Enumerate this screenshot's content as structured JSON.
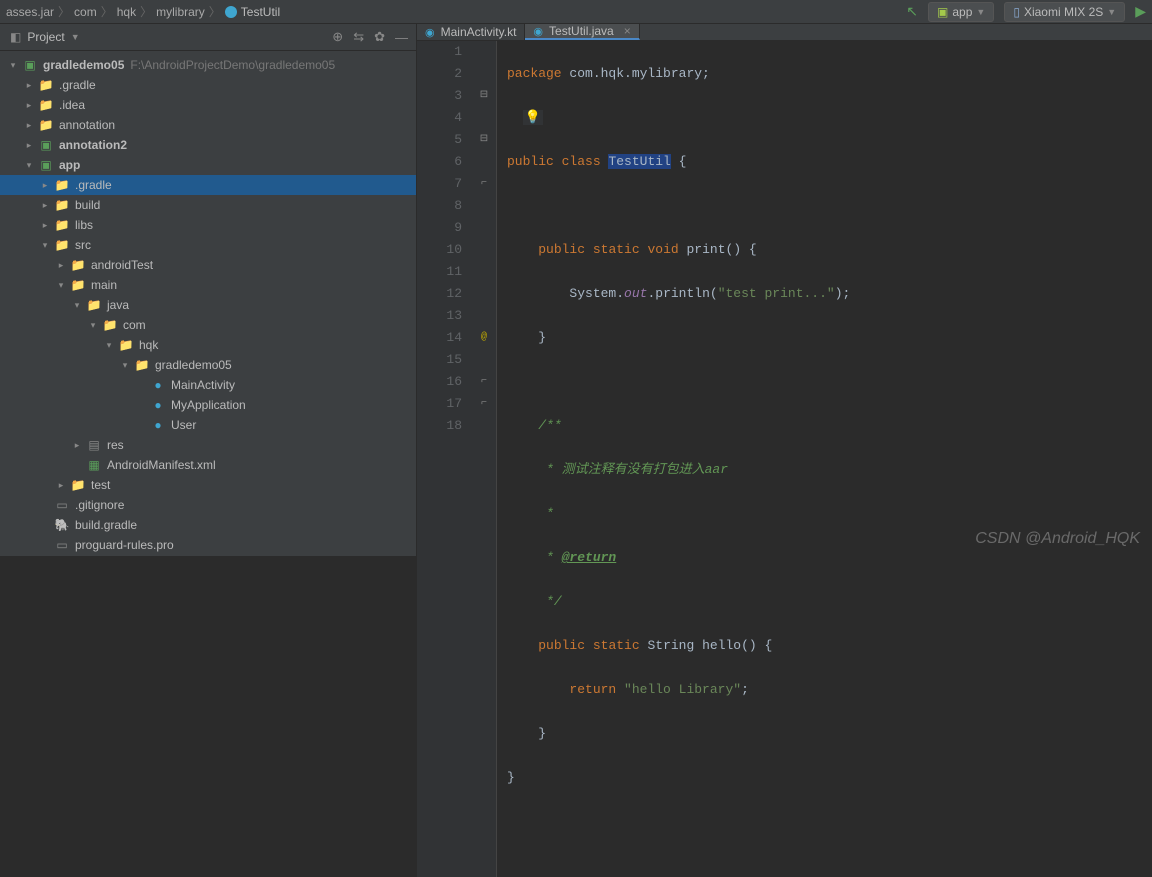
{
  "breadcrumbs": [
    "asses.jar",
    "com",
    "hqk",
    "mylibrary",
    "TestUtil"
  ],
  "toolbar": {
    "config_label": "app",
    "device_label": "Xiaomi MIX 2S"
  },
  "project_panel": {
    "title": "Project"
  },
  "tree": {
    "root": {
      "label": "gradledemo05",
      "path": "F:\\AndroidProjectDemo\\gradledemo05"
    },
    "items": [
      {
        "label": ".gradle",
        "kind": "folder-orange",
        "depth": 1
      },
      {
        "label": ".idea",
        "kind": "folder",
        "depth": 1
      },
      {
        "label": "annotation",
        "kind": "folder",
        "depth": 1
      },
      {
        "label": "annotation2",
        "kind": "module",
        "depth": 1,
        "bold": true
      },
      {
        "label": "app",
        "kind": "module",
        "depth": 1,
        "bold": true,
        "expanded": true
      },
      {
        "label": ".gradle",
        "kind": "folder-orange",
        "depth": 2,
        "selected": true
      },
      {
        "label": "build",
        "kind": "folder-orange",
        "depth": 2
      },
      {
        "label": "libs",
        "kind": "folder",
        "depth": 2
      },
      {
        "label": "src",
        "kind": "folder",
        "depth": 2,
        "expanded": true
      },
      {
        "label": "androidTest",
        "kind": "folder",
        "depth": 3
      },
      {
        "label": "main",
        "kind": "folder",
        "depth": 3,
        "expanded": true
      },
      {
        "label": "java",
        "kind": "folder",
        "depth": 4,
        "expanded": true
      },
      {
        "label": "com",
        "kind": "folder",
        "depth": 5,
        "expanded": true
      },
      {
        "label": "hqk",
        "kind": "folder",
        "depth": 6,
        "expanded": true
      },
      {
        "label": "gradledemo05",
        "kind": "folder",
        "depth": 7,
        "expanded": true
      },
      {
        "label": "MainActivity",
        "kind": "class",
        "depth": 8,
        "leaf": true
      },
      {
        "label": "MyApplication",
        "kind": "class",
        "depth": 8,
        "leaf": true
      },
      {
        "label": "User",
        "kind": "class",
        "depth": 8,
        "leaf": true
      },
      {
        "label": "res",
        "kind": "folder-res",
        "depth": 4
      },
      {
        "label": "AndroidManifest.xml",
        "kind": "manifest",
        "depth": 4,
        "leaf": true
      },
      {
        "label": "test",
        "kind": "folder",
        "depth": 3
      },
      {
        "label": ".gitignore",
        "kind": "txt",
        "depth": 2,
        "leaf": true
      },
      {
        "label": "build.gradle",
        "kind": "gradle",
        "depth": 2,
        "leaf": true
      },
      {
        "label": "proguard-rules.pro",
        "kind": "txt",
        "depth": 2,
        "leaf": true
      }
    ]
  },
  "tabs": [
    {
      "label": "MainActivity.kt",
      "active": false
    },
    {
      "label": "TestUtil.java",
      "active": true
    }
  ],
  "code": {
    "line_numbers": [
      "1",
      "2",
      "3",
      "4",
      "5",
      "6",
      "7",
      "8",
      "9",
      "10",
      "11",
      "12",
      "13",
      "14",
      "15",
      "16",
      "17",
      "18"
    ],
    "package": "package",
    "pkg_name": "com.hqk.mylibrary",
    "public": "public",
    "class": "class",
    "class_name": "TestUtil",
    "static": "static",
    "void": "void",
    "method1": "print",
    "system": "System",
    "out": "out",
    "println": "println",
    "str1": "\"test print...\"",
    "doc_open": "/**",
    "doc_line1": " * 测试注释有没有打包进入aar",
    "doc_line2": " * ",
    "doc_tag": "@return",
    "doc_close": " */",
    "string_type": "String",
    "method2": "hello",
    "return": "return",
    "str2": "\"hello Library\""
  },
  "watermark": "CSDN @Android_HQK"
}
